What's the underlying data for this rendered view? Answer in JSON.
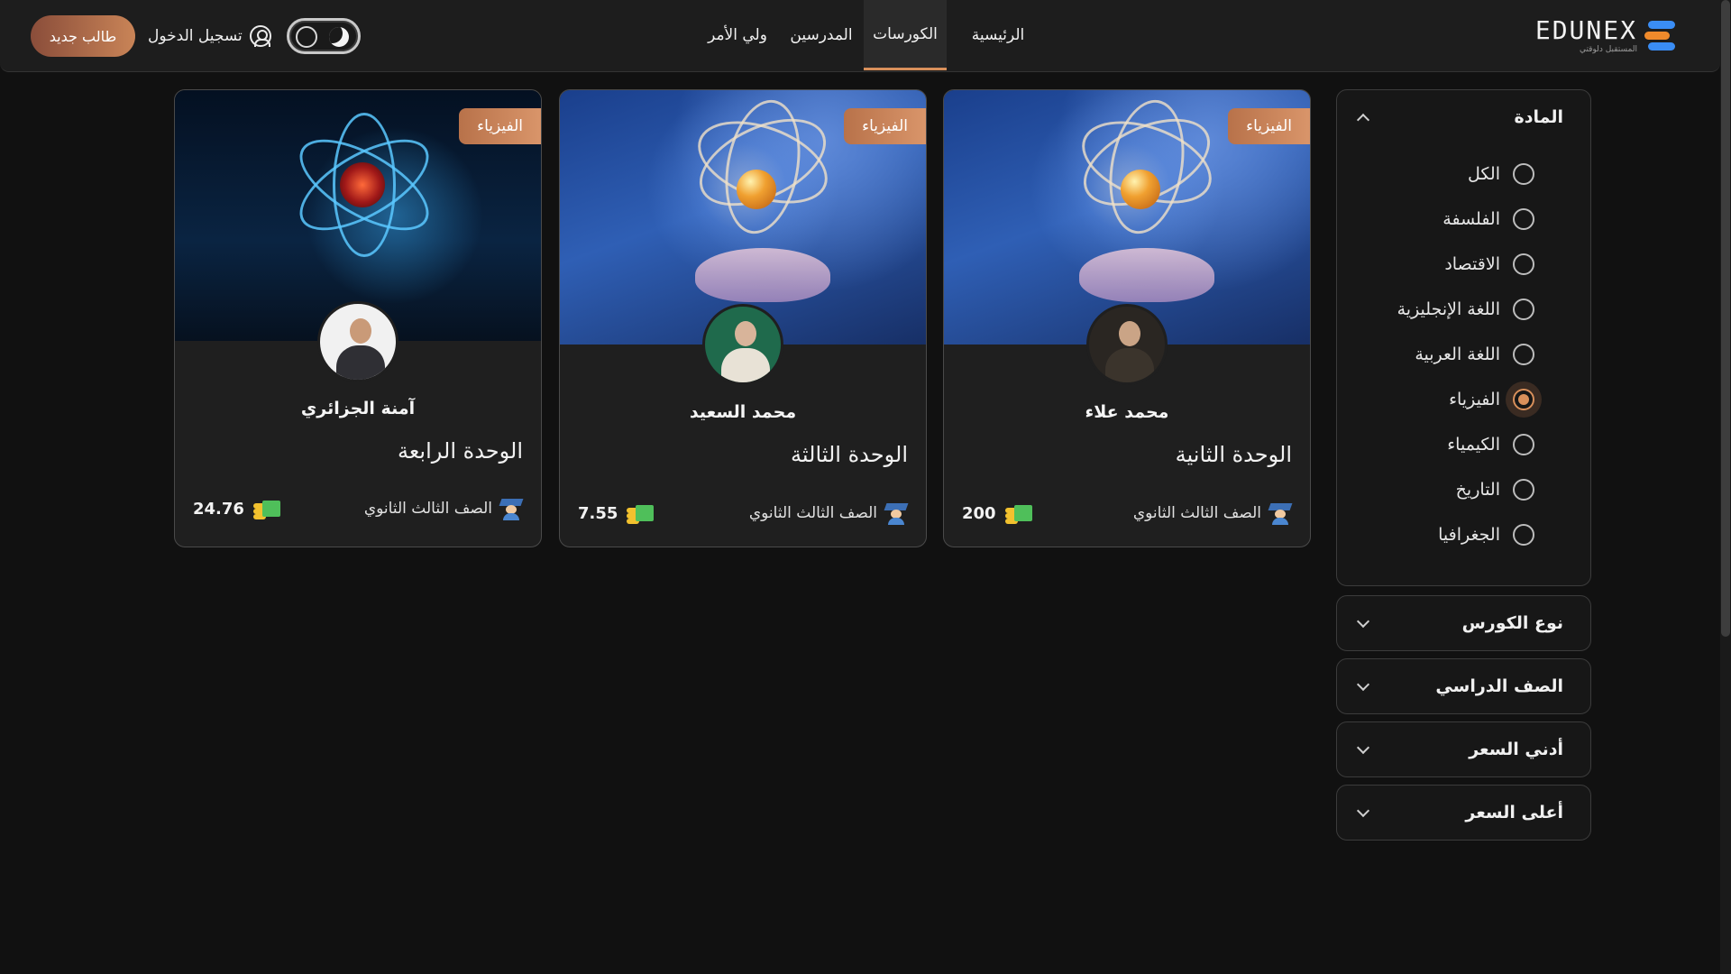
{
  "brand": {
    "logo_word": "EDUNEX",
    "logo_sub": "المستقبل دلوقتي"
  },
  "nav": {
    "items": [
      "الرئيسية",
      "الكورسات",
      "المدرسين",
      "ولي الأمر"
    ],
    "active": "الكورسات"
  },
  "auth": {
    "login_label": "تسجيل الدخول",
    "signup_label": "طالب جديد"
  },
  "filters": {
    "subject": {
      "title": "المادة",
      "options": [
        "الكل",
        "الفلسفة",
        "الاقتصاد",
        "اللغة الإنجليزية",
        "اللغة العربية",
        "الفيزياء",
        "الكيمياء",
        "التاريخ",
        "الجغرافيا"
      ],
      "selected": "الفيزياء"
    },
    "collapsed": [
      "نوع الكورس",
      "الصف الدراسي",
      "أدني السعر",
      "أعلى السعر"
    ]
  },
  "courses": [
    {
      "subject": "الفيزياء",
      "teacher": "محمد علاء",
      "title": "الوحدة الثانية",
      "grade": "الصف الثالث الثانوي",
      "price": "200"
    },
    {
      "subject": "الفيزياء",
      "teacher": "محمد السعيد",
      "title": "الوحدة الثالثة",
      "grade": "الصف الثالث الثانوي",
      "price": "7.55"
    },
    {
      "subject": "الفيزياء",
      "teacher": "آمنة الجزائري",
      "title": "الوحدة الرابعة",
      "grade": "الصف الثالث الثانوي",
      "price": "24.76"
    }
  ],
  "colors": {
    "accent": "#d9905b",
    "background": "#111111",
    "card": "#1f1f1f"
  }
}
